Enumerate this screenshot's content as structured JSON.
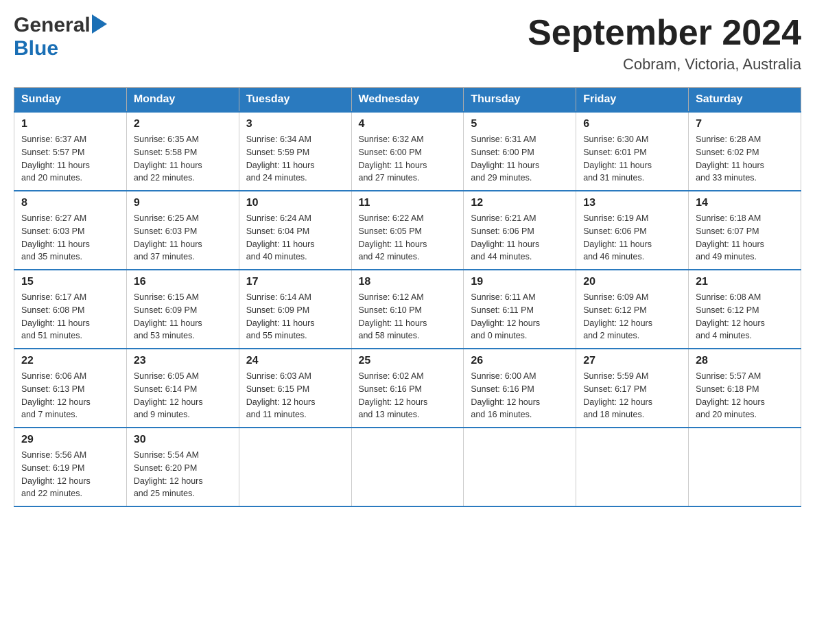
{
  "header": {
    "logo_general": "General",
    "logo_blue": "Blue",
    "main_title": "September 2024",
    "subtitle": "Cobram, Victoria, Australia"
  },
  "calendar": {
    "days_of_week": [
      "Sunday",
      "Monday",
      "Tuesday",
      "Wednesday",
      "Thursday",
      "Friday",
      "Saturday"
    ],
    "weeks": [
      [
        {
          "day": "1",
          "sunrise": "6:37 AM",
          "sunset": "5:57 PM",
          "daylight": "11 hours and 20 minutes."
        },
        {
          "day": "2",
          "sunrise": "6:35 AM",
          "sunset": "5:58 PM",
          "daylight": "11 hours and 22 minutes."
        },
        {
          "day": "3",
          "sunrise": "6:34 AM",
          "sunset": "5:59 PM",
          "daylight": "11 hours and 24 minutes."
        },
        {
          "day": "4",
          "sunrise": "6:32 AM",
          "sunset": "6:00 PM",
          "daylight": "11 hours and 27 minutes."
        },
        {
          "day": "5",
          "sunrise": "6:31 AM",
          "sunset": "6:00 PM",
          "daylight": "11 hours and 29 minutes."
        },
        {
          "day": "6",
          "sunrise": "6:30 AM",
          "sunset": "6:01 PM",
          "daylight": "11 hours and 31 minutes."
        },
        {
          "day": "7",
          "sunrise": "6:28 AM",
          "sunset": "6:02 PM",
          "daylight": "11 hours and 33 minutes."
        }
      ],
      [
        {
          "day": "8",
          "sunrise": "6:27 AM",
          "sunset": "6:03 PM",
          "daylight": "11 hours and 35 minutes."
        },
        {
          "day": "9",
          "sunrise": "6:25 AM",
          "sunset": "6:03 PM",
          "daylight": "11 hours and 37 minutes."
        },
        {
          "day": "10",
          "sunrise": "6:24 AM",
          "sunset": "6:04 PM",
          "daylight": "11 hours and 40 minutes."
        },
        {
          "day": "11",
          "sunrise": "6:22 AM",
          "sunset": "6:05 PM",
          "daylight": "11 hours and 42 minutes."
        },
        {
          "day": "12",
          "sunrise": "6:21 AM",
          "sunset": "6:06 PM",
          "daylight": "11 hours and 44 minutes."
        },
        {
          "day": "13",
          "sunrise": "6:19 AM",
          "sunset": "6:06 PM",
          "daylight": "11 hours and 46 minutes."
        },
        {
          "day": "14",
          "sunrise": "6:18 AM",
          "sunset": "6:07 PM",
          "daylight": "11 hours and 49 minutes."
        }
      ],
      [
        {
          "day": "15",
          "sunrise": "6:17 AM",
          "sunset": "6:08 PM",
          "daylight": "11 hours and 51 minutes."
        },
        {
          "day": "16",
          "sunrise": "6:15 AM",
          "sunset": "6:09 PM",
          "daylight": "11 hours and 53 minutes."
        },
        {
          "day": "17",
          "sunrise": "6:14 AM",
          "sunset": "6:09 PM",
          "daylight": "11 hours and 55 minutes."
        },
        {
          "day": "18",
          "sunrise": "6:12 AM",
          "sunset": "6:10 PM",
          "daylight": "11 hours and 58 minutes."
        },
        {
          "day": "19",
          "sunrise": "6:11 AM",
          "sunset": "6:11 PM",
          "daylight": "12 hours and 0 minutes."
        },
        {
          "day": "20",
          "sunrise": "6:09 AM",
          "sunset": "6:12 PM",
          "daylight": "12 hours and 2 minutes."
        },
        {
          "day": "21",
          "sunrise": "6:08 AM",
          "sunset": "6:12 PM",
          "daylight": "12 hours and 4 minutes."
        }
      ],
      [
        {
          "day": "22",
          "sunrise": "6:06 AM",
          "sunset": "6:13 PM",
          "daylight": "12 hours and 7 minutes."
        },
        {
          "day": "23",
          "sunrise": "6:05 AM",
          "sunset": "6:14 PM",
          "daylight": "12 hours and 9 minutes."
        },
        {
          "day": "24",
          "sunrise": "6:03 AM",
          "sunset": "6:15 PM",
          "daylight": "12 hours and 11 minutes."
        },
        {
          "day": "25",
          "sunrise": "6:02 AM",
          "sunset": "6:16 PM",
          "daylight": "12 hours and 13 minutes."
        },
        {
          "day": "26",
          "sunrise": "6:00 AM",
          "sunset": "6:16 PM",
          "daylight": "12 hours and 16 minutes."
        },
        {
          "day": "27",
          "sunrise": "5:59 AM",
          "sunset": "6:17 PM",
          "daylight": "12 hours and 18 minutes."
        },
        {
          "day": "28",
          "sunrise": "5:57 AM",
          "sunset": "6:18 PM",
          "daylight": "12 hours and 20 minutes."
        }
      ],
      [
        {
          "day": "29",
          "sunrise": "5:56 AM",
          "sunset": "6:19 PM",
          "daylight": "12 hours and 22 minutes."
        },
        {
          "day": "30",
          "sunrise": "5:54 AM",
          "sunset": "6:20 PM",
          "daylight": "12 hours and 25 minutes."
        },
        null,
        null,
        null,
        null,
        null
      ]
    ]
  },
  "labels": {
    "sunrise": "Sunrise:",
    "sunset": "Sunset:",
    "daylight": "Daylight:"
  }
}
